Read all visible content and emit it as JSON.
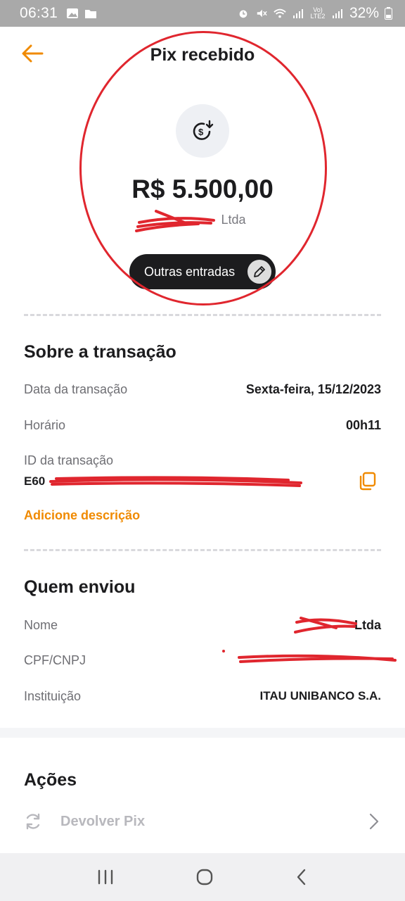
{
  "status_bar": {
    "time": "06:31",
    "battery": "32%",
    "network_label": "Vo) LTE2"
  },
  "header": {
    "title": "Pix recebido"
  },
  "summary": {
    "amount": "R$ 5.500,00",
    "payer_name_visible": "Ltda",
    "chip_label": "Outras entradas"
  },
  "transaction": {
    "section_title": "Sobre a transação",
    "date_label": "Data da transação",
    "date_value": "Sexta-feira, 15/12/2023",
    "time_label": "Horário",
    "time_value": "00h11",
    "id_label": "ID da transação",
    "id_value": "E60",
    "add_description": "Adicione descrição"
  },
  "sender": {
    "section_title": "Quem enviou",
    "name_label": "Nome",
    "name_value": "Ltda",
    "doc_label": "CPF/CNPJ",
    "institution_label": "Instituição",
    "institution_value": "ITAU UNIBANCO S.A."
  },
  "actions": {
    "section_title": "Ações",
    "refund_label": "Devolver Pix"
  },
  "colors": {
    "accent": "#f08a00",
    "annotation": "#e0262e",
    "dark": "#1c1c1e"
  }
}
